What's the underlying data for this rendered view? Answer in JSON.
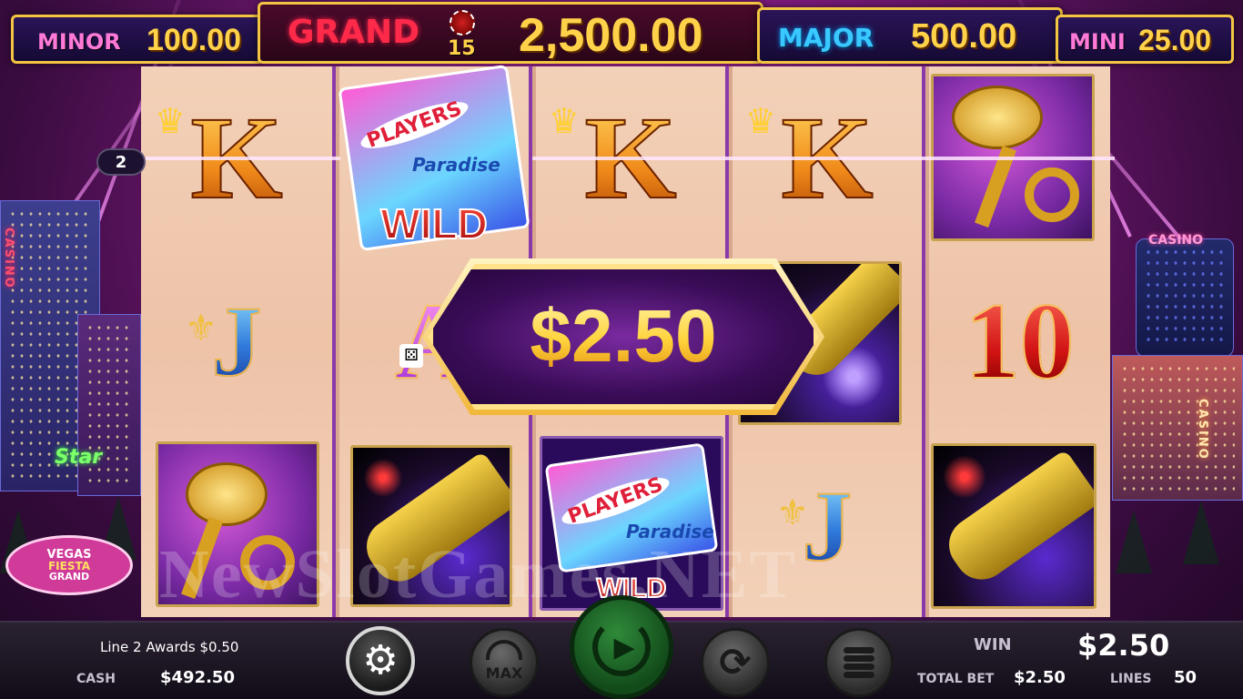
{
  "jackpots": {
    "minor": {
      "label": "MINOR",
      "value": "100.00"
    },
    "grand": {
      "label": "GRAND",
      "value": "2,500.00",
      "counter": "15"
    },
    "major": {
      "label": "MAJOR",
      "value": "500.00"
    },
    "mini": {
      "label": "MINI",
      "value": "25.00"
    }
  },
  "reels": {
    "reel1": [
      "K",
      "J",
      "trumpet"
    ],
    "reel2": [
      "wild",
      "A",
      "champagne"
    ],
    "reel3": [
      "K",
      "champagne",
      "wild"
    ],
    "reel4": [
      "K",
      "champagne",
      "J"
    ],
    "reel5": [
      "trumpet",
      "10",
      "champagne"
    ]
  },
  "symbols": {
    "wild_text": "WILD",
    "players_text": "PLAYERS",
    "paradise_text": "Paradise"
  },
  "win_banner": {
    "amount": "$2.50"
  },
  "payline_marker": "2",
  "scenery": {
    "casino_left": "CASINO",
    "casino_right_top": "CASINO",
    "casino_right_side": "CASINO",
    "star_sign": "Star",
    "logo_top": "VEGAS",
    "logo_mid": "FIESTA",
    "logo_bot": "GRAND"
  },
  "watermark": "NewSlotGames.NET",
  "bottom_bar": {
    "message": "Line 2 Awards $0.50",
    "cash_label": "CASH",
    "cash_value": "$492.50",
    "win_label": "WIN",
    "win_value": "$2.50",
    "total_bet_label": "TOTAL BET",
    "total_bet_value": "$2.50",
    "lines_label": "LINES",
    "lines_value": "50",
    "max_label": "MAX"
  },
  "colors": {
    "accent_gold": "#f4c542",
    "spin_green": "#1f6a2a",
    "bg_purple": "#7b1a7a"
  }
}
